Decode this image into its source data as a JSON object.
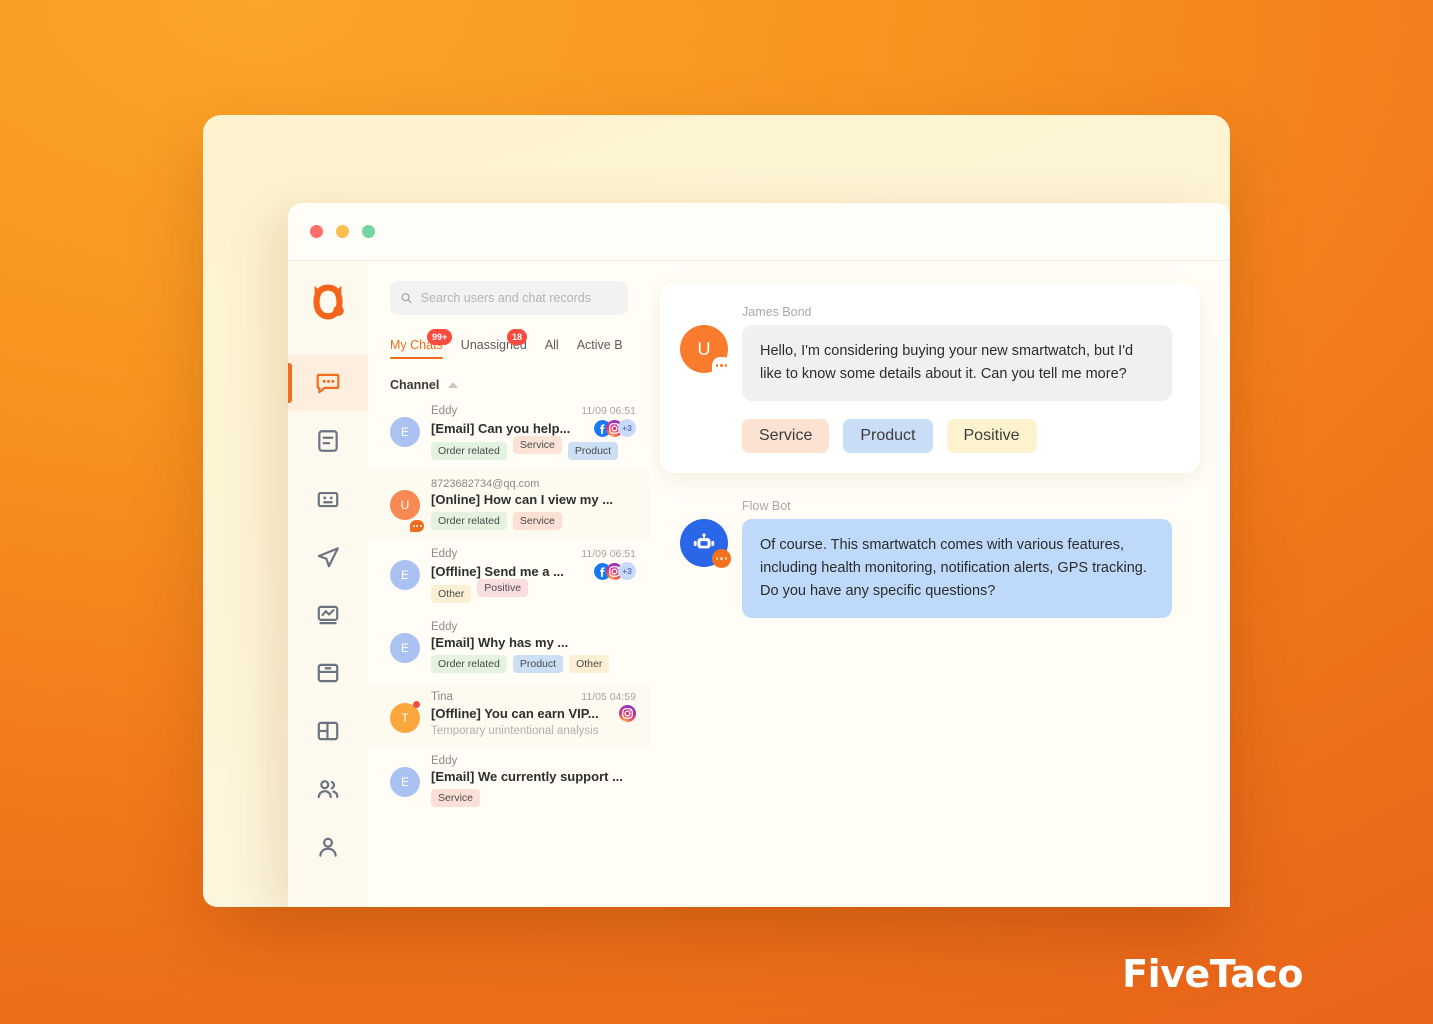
{
  "brand": {
    "logo_icon": "bull-logo-icon",
    "watermark": "FiveTaco"
  },
  "titlebar": {
    "close_label": "",
    "minimize_label": "",
    "maximize_label": ""
  },
  "rail": {
    "items": [
      {
        "icon": "chat-bubble-icon",
        "active": true
      },
      {
        "icon": "document-icon",
        "active": false
      },
      {
        "icon": "bot-face-icon",
        "active": false
      },
      {
        "icon": "send-paper-plane-icon",
        "active": false
      },
      {
        "icon": "analytics-monitor-icon",
        "active": false
      },
      {
        "icon": "archive-box-icon",
        "active": false
      },
      {
        "icon": "layout-panels-icon",
        "active": false
      },
      {
        "icon": "team-group-icon",
        "active": false
      },
      {
        "icon": "user-profile-icon",
        "active": false
      }
    ]
  },
  "search": {
    "icon": "search-icon",
    "placeholder": "Search users and chat records",
    "value": ""
  },
  "tabs": [
    {
      "label": "My Chats",
      "badge": "99+",
      "active": true
    },
    {
      "label": "Unassigned",
      "badge": "18",
      "active": false
    },
    {
      "label": "All",
      "badge": "",
      "active": false
    },
    {
      "label": "Active B",
      "badge": "",
      "active": false
    }
  ],
  "group_header": {
    "label": "Channel",
    "caret_icon": "caret-up-icon"
  },
  "chat_rows": [
    {
      "avatar_letter": "E",
      "avatar_color": "av-blue",
      "avatar_badge": "none",
      "name": "Eddy",
      "name_is_email": false,
      "time": "11/09 06:51",
      "preview": "[Email] Can you help...",
      "sub": "",
      "channels": [
        "facebook-icon",
        "instagram-icon"
      ],
      "channels_more": "+3",
      "tags": [
        {
          "label": "Order related",
          "style": "tag-green"
        },
        {
          "label": "Service",
          "style": "tag-peach"
        },
        {
          "label": "Product",
          "style": "tag-blue"
        }
      ],
      "highlight": false
    },
    {
      "avatar_letter": "U",
      "avatar_color": "av-orange",
      "avatar_badge": "chat",
      "name": "8723682734@qq.com",
      "name_is_email": true,
      "time": "",
      "preview": "[Online] How can I view my ...",
      "sub": "",
      "channels": [],
      "channels_more": "",
      "tags": [
        {
          "label": "Order related",
          "style": "tag-green"
        },
        {
          "label": "Service",
          "style": "tag-peach-flat"
        }
      ],
      "highlight": true
    },
    {
      "avatar_letter": "E",
      "avatar_color": "av-blue",
      "avatar_badge": "none",
      "name": "Eddy",
      "name_is_email": false,
      "time": "11/09 06:51",
      "preview": "[Offline] Send me a ...",
      "sub": "",
      "channels": [
        "facebook-icon",
        "instagram-icon"
      ],
      "channels_more": "+3",
      "tags": [
        {
          "label": "Other",
          "style": "tag-amber"
        },
        {
          "label": "Positive",
          "style": "tag-pink"
        }
      ],
      "highlight": false
    },
    {
      "avatar_letter": "E",
      "avatar_color": "av-blue",
      "avatar_badge": "none",
      "name": "Eddy",
      "name_is_email": false,
      "time": "",
      "preview": "[Email] Why has my ...",
      "sub": "",
      "channels": [],
      "channels_more": "",
      "tags": [
        {
          "label": "Order related",
          "style": "tag-green"
        },
        {
          "label": "Product",
          "style": "tag-blue"
        },
        {
          "label": "Other",
          "style": "tag-amber"
        }
      ],
      "highlight": false
    },
    {
      "avatar_letter": "T",
      "avatar_color": "av-amber",
      "avatar_badge": "dot",
      "name": "Tina",
      "name_is_email": false,
      "time": "11/05 04:59",
      "preview": "[Offline] You can earn VIP...",
      "sub": "Temporary unintentional analysis",
      "channels": [
        "instagram-icon"
      ],
      "channels_more": "",
      "tags": [],
      "highlight": true
    },
    {
      "avatar_letter": "E",
      "avatar_color": "av-blue",
      "avatar_badge": "none",
      "name": "Eddy",
      "name_is_email": false,
      "time": "",
      "preview": "[Email] We currently support ...",
      "sub": "",
      "channels": [],
      "channels_more": "",
      "tags": [
        {
          "label": "Service",
          "style": "tag-peach-flat"
        }
      ],
      "highlight": false
    }
  ],
  "conversation": {
    "messages": [
      {
        "sender": "James Bond",
        "avatar_letter": "U",
        "avatar_kind": "user",
        "avatar_badge": "chat",
        "text": "Hello, I'm considering buying your new smartwatch, but I'd like to know some details about it. Can you tell me more?",
        "bubble_style": "grey",
        "carded": true,
        "tags": [
          {
            "label": "Service",
            "style": "service"
          },
          {
            "label": "Product",
            "style": "product"
          },
          {
            "label": "Positive",
            "style": "positive"
          }
        ]
      },
      {
        "sender": "Flow Bot",
        "avatar_letter": "",
        "avatar_kind": "bot",
        "avatar_badge": "bot",
        "text": "Of course. This smartwatch comes with various features, including health monitoring, notification alerts, GPS tracking. Do you have any specific questions?",
        "bubble_style": "blue",
        "carded": false,
        "tags": []
      }
    ]
  },
  "colors": {
    "brand_orange": "#f26c1f",
    "page_bg_orange": "#f7931e",
    "card_cream": "#fdf3cf",
    "window_bg": "#fffdf6",
    "badge_red": "#fb4a3f",
    "bot_blue": "#2a66e8",
    "bubble_blue": "#bfd9fb",
    "bubble_grey": "#f0f0f0"
  }
}
